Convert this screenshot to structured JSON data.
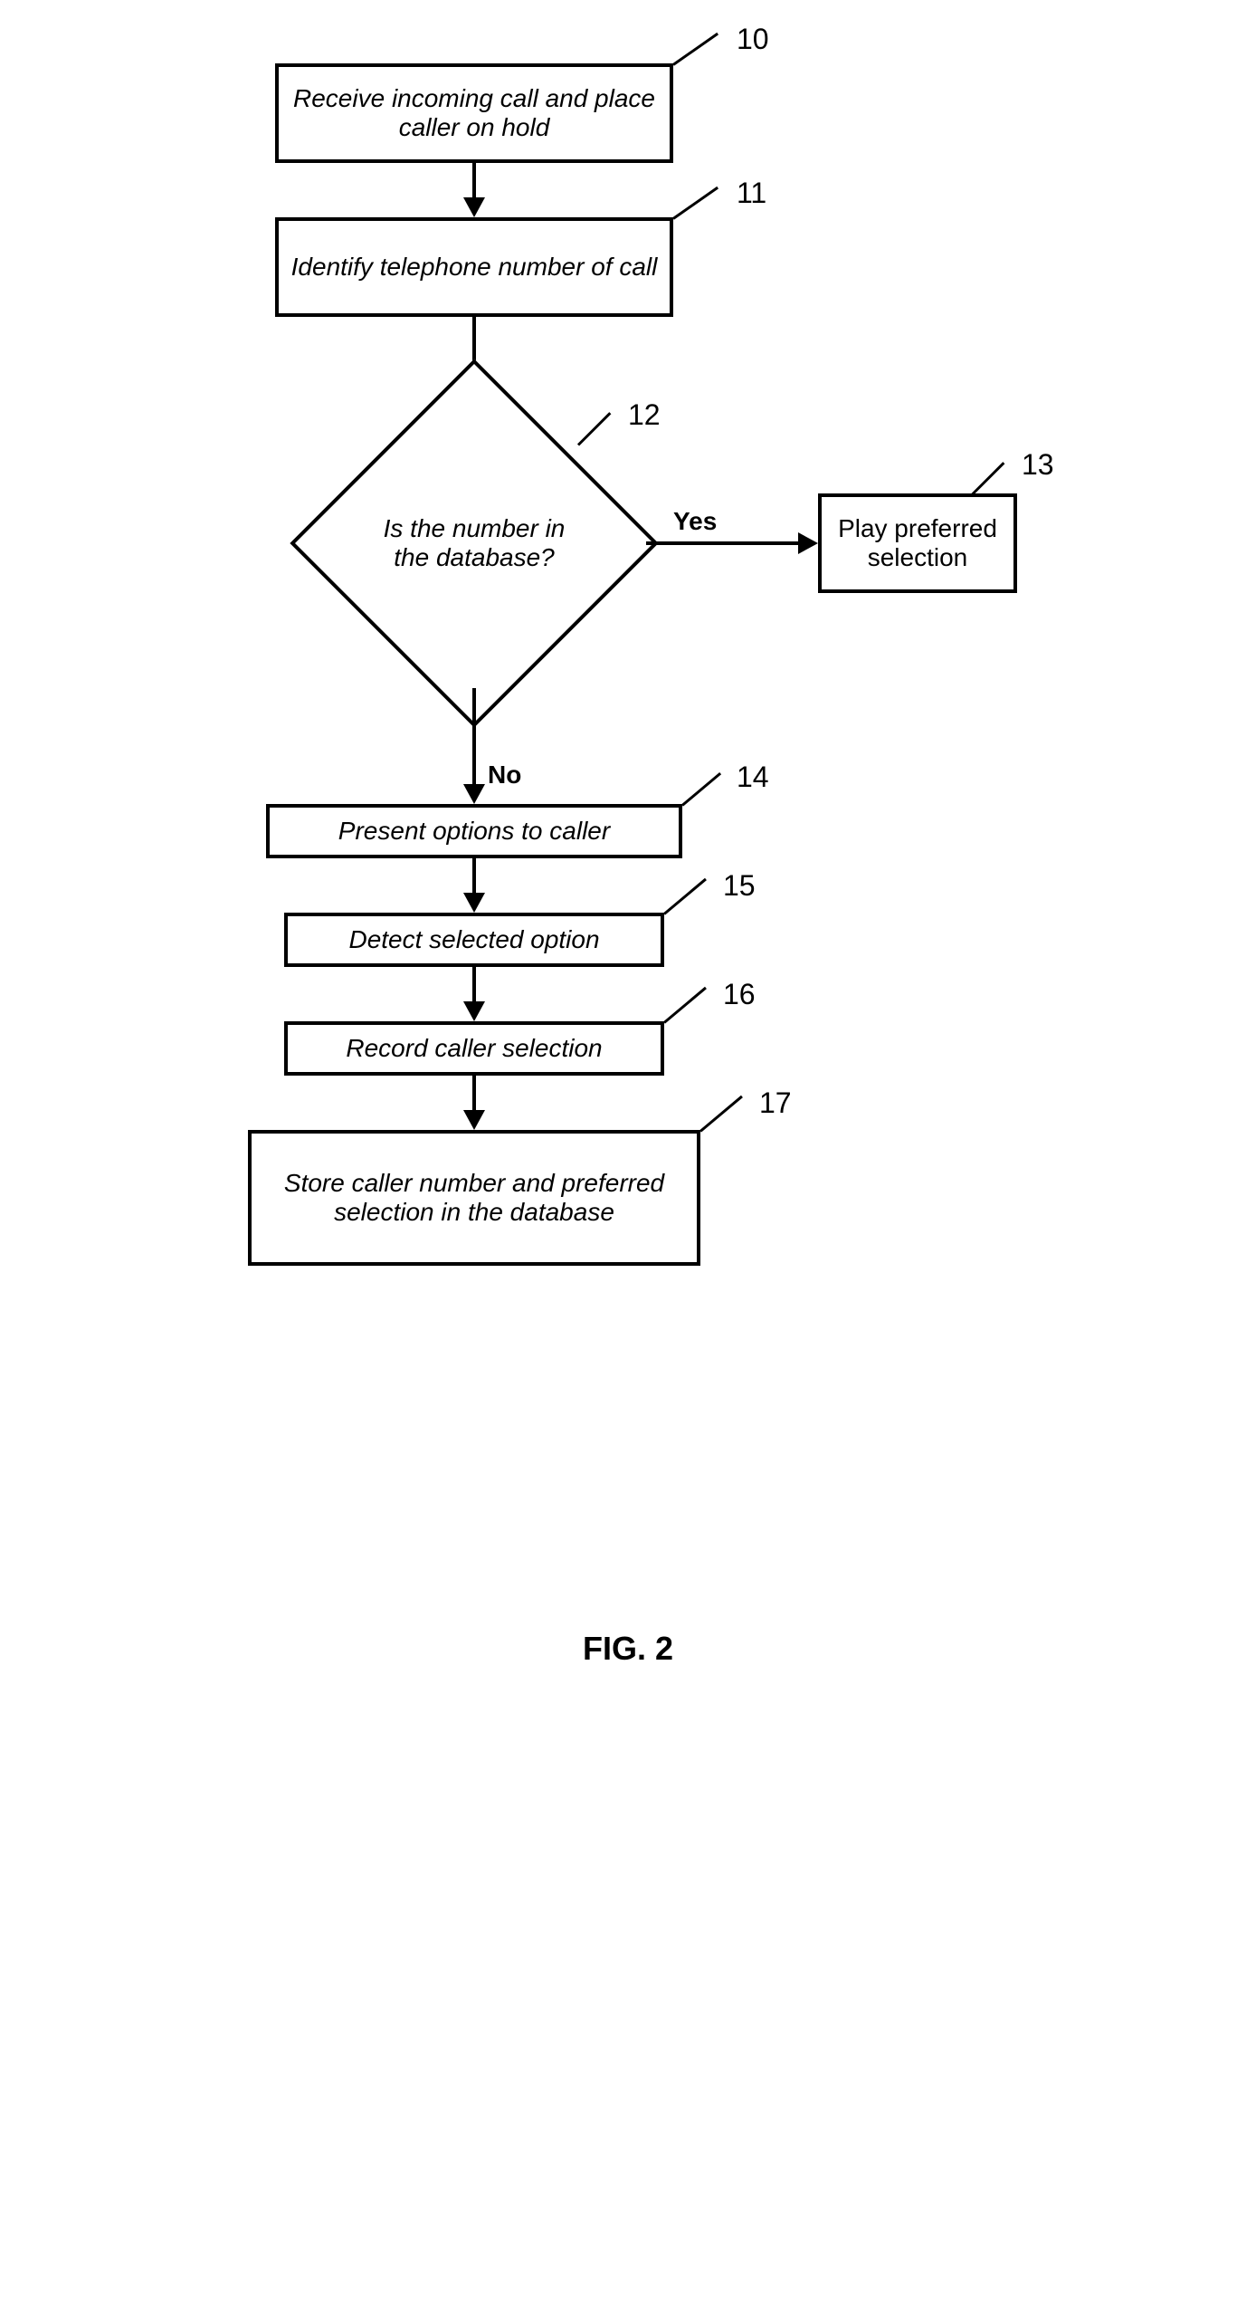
{
  "figure_label": "FIG. 2",
  "nodes": {
    "n10": {
      "text": "Receive incoming call and place caller on hold",
      "ref": "10"
    },
    "n11": {
      "text": "Identify telephone number of call",
      "ref": "11"
    },
    "n12": {
      "text": "Is the number in the database?",
      "ref": "12"
    },
    "n13": {
      "text": "Play preferred selection",
      "ref": "13"
    },
    "n14": {
      "text": "Present options to caller",
      "ref": "14"
    },
    "n15": {
      "text": "Detect selected option",
      "ref": "15"
    },
    "n16": {
      "text": "Record caller selection",
      "ref": "16"
    },
    "n17": {
      "text": "Store caller number and preferred selection in the database",
      "ref": "17"
    }
  },
  "edge_labels": {
    "yes": "Yes",
    "no": "No"
  }
}
